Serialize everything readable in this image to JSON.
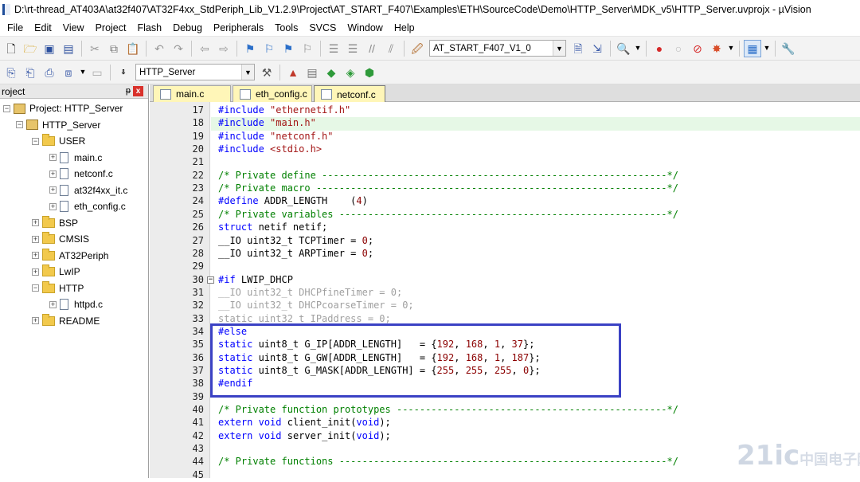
{
  "window": {
    "title": "D:\\rt-thread_AT403A\\at32f407\\AT32F4xx_StdPeriph_Lib_V1.2.9\\Project\\AT_START_F407\\Examples\\ETH\\SourceCode\\Demo\\HTTP_Server\\MDK_v5\\HTTP_Server.uvprojx - µVision"
  },
  "menu": [
    "File",
    "Edit",
    "View",
    "Project",
    "Flash",
    "Debug",
    "Peripherals",
    "Tools",
    "SVCS",
    "Window",
    "Help"
  ],
  "toolbar1": {
    "target_select": "AT_START_F407_V1_0"
  },
  "toolbar2": {
    "project_select": "HTTP_Server"
  },
  "project_panel": {
    "title": "roject",
    "pin": "ᵽ",
    "close": "x",
    "tree": [
      {
        "label": "Project: HTTP_Server",
        "level": 0,
        "kind": "project",
        "expander": "−"
      },
      {
        "label": "HTTP_Server",
        "level": 1,
        "kind": "project",
        "expander": "−"
      },
      {
        "label": "USER",
        "level": 2,
        "kind": "folder",
        "expander": "−"
      },
      {
        "label": "main.c",
        "level": 3,
        "kind": "file",
        "expander": "+"
      },
      {
        "label": "netconf.c",
        "level": 3,
        "kind": "file",
        "expander": "+"
      },
      {
        "label": "at32f4xx_it.c",
        "level": 3,
        "kind": "file",
        "expander": "+"
      },
      {
        "label": "eth_config.c",
        "level": 3,
        "kind": "file",
        "expander": "+"
      },
      {
        "label": "BSP",
        "level": 2,
        "kind": "folder",
        "expander": "+"
      },
      {
        "label": "CMSIS",
        "level": 2,
        "kind": "folder",
        "expander": "+"
      },
      {
        "label": "AT32Periph",
        "level": 2,
        "kind": "folder",
        "expander": "+"
      },
      {
        "label": "LwIP",
        "level": 2,
        "kind": "folder",
        "expander": "+"
      },
      {
        "label": "HTTP",
        "level": 2,
        "kind": "folder",
        "expander": "−"
      },
      {
        "label": "httpd.c",
        "level": 3,
        "kind": "file",
        "expander": "+"
      },
      {
        "label": "README",
        "level": 2,
        "kind": "folder",
        "expander": "+"
      }
    ]
  },
  "tabs": [
    {
      "label": "main.c",
      "color": "#fff6b8",
      "active": false
    },
    {
      "label": "eth_config.c",
      "color": "#fff6b8",
      "active": false
    },
    {
      "label": "netconf.c",
      "color": "#fff6b8",
      "active": true
    }
  ],
  "editor": {
    "highlight_line": 18,
    "lines": [
      {
        "n": "17",
        "t": "#include \"ethernetif.h\""
      },
      {
        "n": "18",
        "t": "#include \"main.h\""
      },
      {
        "n": "19",
        "t": "#include \"netconf.h\""
      },
      {
        "n": "20",
        "t": "#include <stdio.h>"
      },
      {
        "n": "21",
        "t": ""
      },
      {
        "n": "22",
        "t": "/* Private define ------------------------------------------------------------*/"
      },
      {
        "n": "23",
        "t": "/* Private macro -------------------------------------------------------------*/"
      },
      {
        "n": "24",
        "t": "#define ADDR_LENGTH    (4)"
      },
      {
        "n": "25",
        "t": "/* Private variables ---------------------------------------------------------*/"
      },
      {
        "n": "26",
        "t": "struct netif netif;"
      },
      {
        "n": "27",
        "t": "__IO uint32_t TCPTimer = 0;"
      },
      {
        "n": "28",
        "t": "__IO uint32_t ARPTimer = 0;"
      },
      {
        "n": "29",
        "t": ""
      },
      {
        "n": "30",
        "t": "#if LWIP_DHCP"
      },
      {
        "n": "31",
        "t": "__IO uint32_t DHCPfineTimer = 0;"
      },
      {
        "n": "32",
        "t": "__IO uint32_t DHCPcoarseTimer = 0;"
      },
      {
        "n": "33",
        "t": "static uint32_t IPaddress = 0;"
      },
      {
        "n": "34",
        "t": "#else"
      },
      {
        "n": "35",
        "t": "static uint8_t G_IP[ADDR_LENGTH]   = {192, 168, 1, 37};"
      },
      {
        "n": "36",
        "t": "static uint8_t G_GW[ADDR_LENGTH]   = {192, 168, 1, 187};"
      },
      {
        "n": "37",
        "t": "static uint8_t G_MASK[ADDR_LENGTH] = {255, 255, 255, 0};"
      },
      {
        "n": "38",
        "t": "#endif"
      },
      {
        "n": "39",
        "t": ""
      },
      {
        "n": "40",
        "t": "/* Private function prototypes -----------------------------------------------*/"
      },
      {
        "n": "41",
        "t": "extern void client_init(void);"
      },
      {
        "n": "42",
        "t": "extern void server_init(void);"
      },
      {
        "n": "43",
        "t": ""
      },
      {
        "n": "44",
        "t": "/* Private functions ---------------------------------------------------------*/"
      },
      {
        "n": "45",
        "t": ""
      }
    ]
  },
  "watermark": {
    "text": "21ic",
    "sub": "中国电子网"
  }
}
